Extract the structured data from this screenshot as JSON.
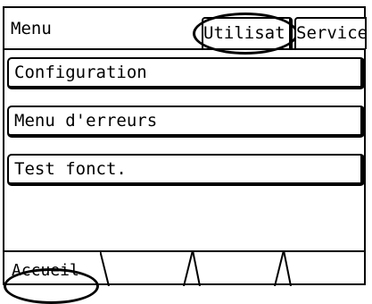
{
  "header": {
    "title": "Menu",
    "tabs": [
      {
        "label": "Utilisat.",
        "highlighted": true
      },
      {
        "label": "Service",
        "highlighted": false
      }
    ]
  },
  "menu": {
    "items": [
      {
        "label": "Configuration"
      },
      {
        "label": "Menu d'erreurs"
      },
      {
        "label": "Test fonct."
      }
    ]
  },
  "footer": {
    "tabs": [
      {
        "label": "Accueil",
        "highlighted": true
      },
      {
        "label": ""
      },
      {
        "label": ""
      },
      {
        "label": ""
      }
    ]
  }
}
